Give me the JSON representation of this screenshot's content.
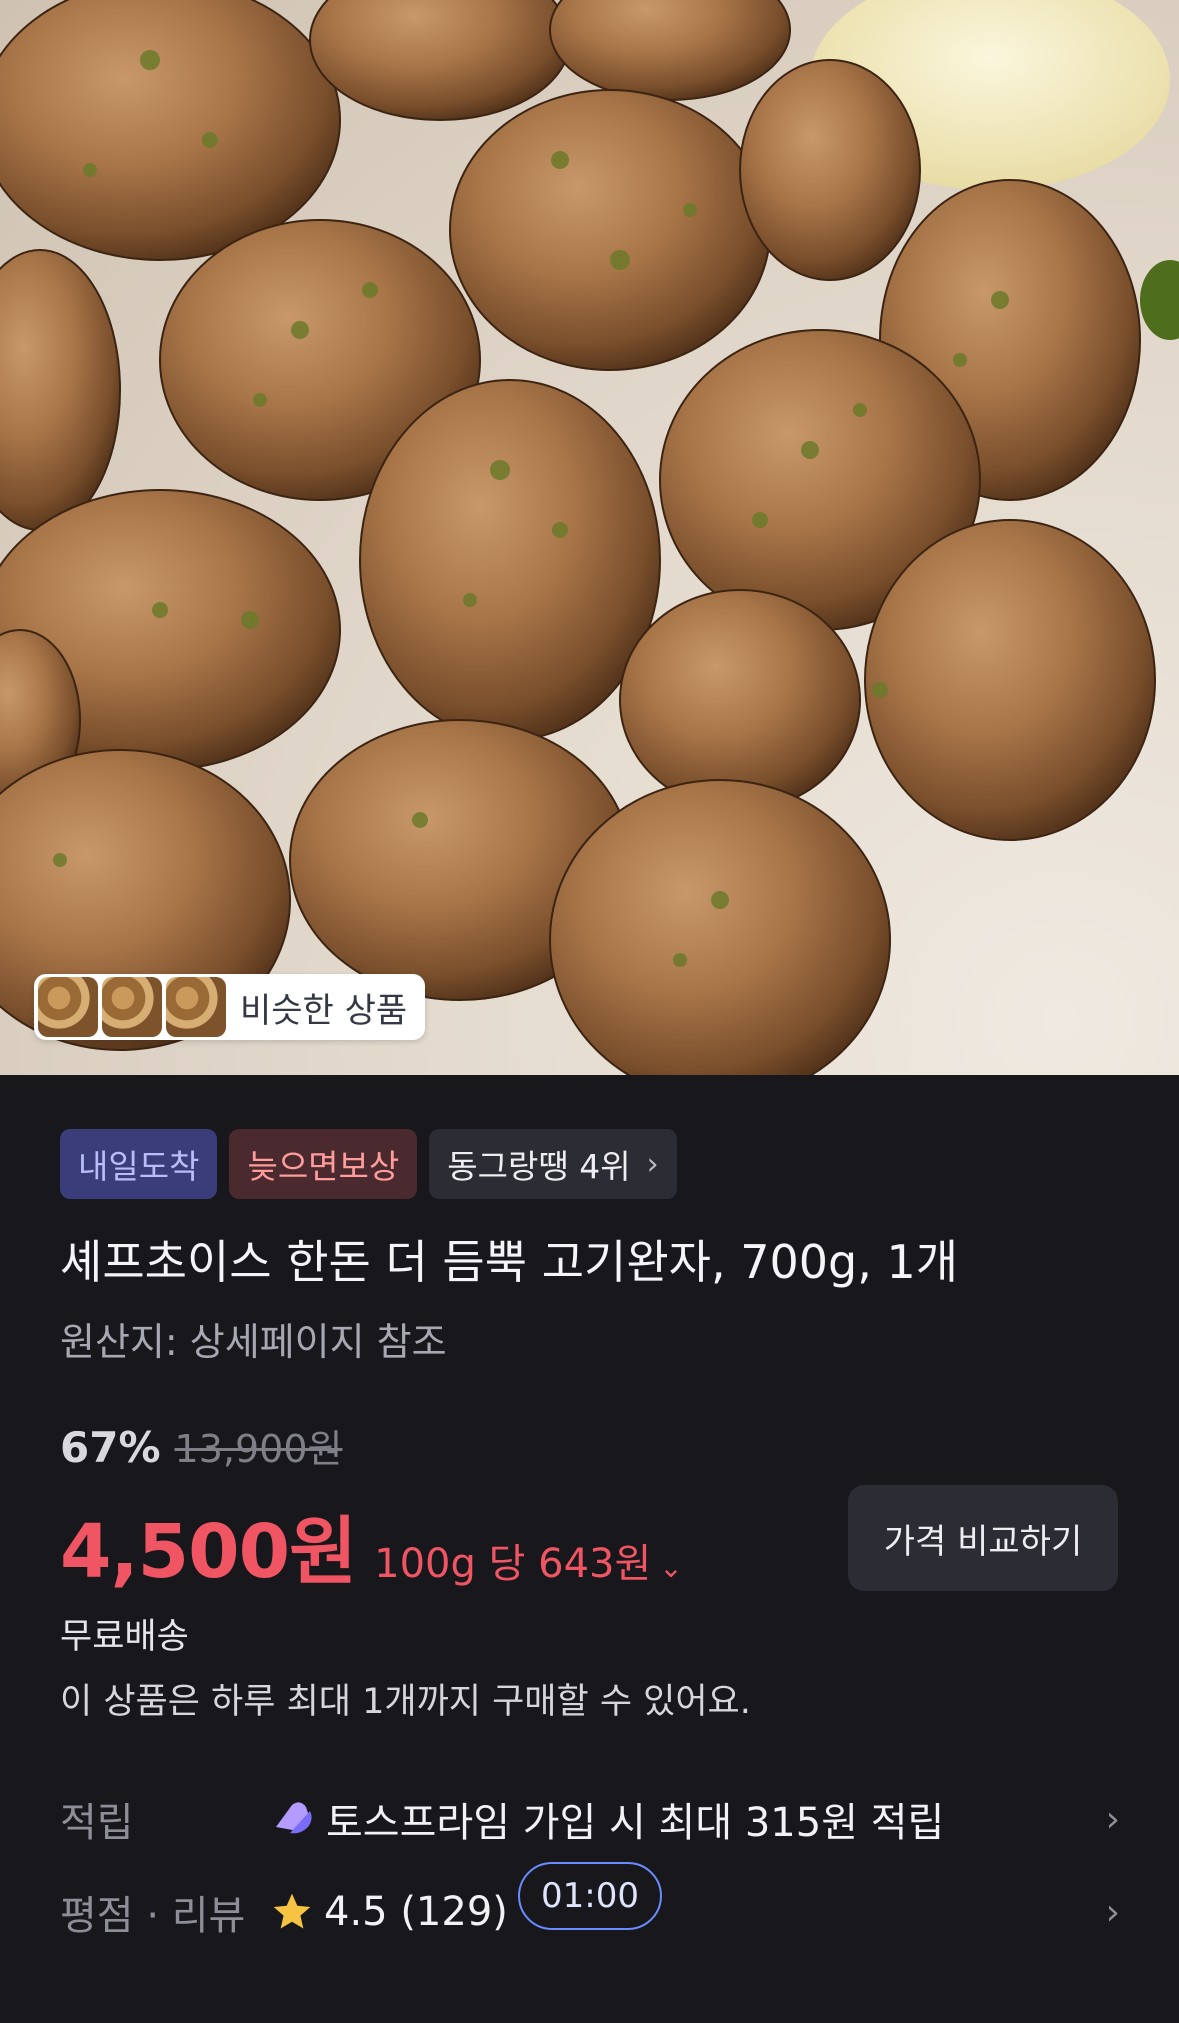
{
  "hero": {
    "image": "meatballs-product-photo",
    "similar_label": "비슷한 상품"
  },
  "tags": [
    {
      "label": "내일도착"
    },
    {
      "label": "늦으면보상"
    },
    {
      "label": "동그랑땡 4위"
    }
  ],
  "product": {
    "title": "셰프초이스 한돈 더 듬뿍 고기완자, 700g, 1개",
    "origin": "원산지: 상세페이지 참조",
    "discount": "67%",
    "original_price": "13,900원",
    "price": "4,500원",
    "unit_price": "100g 당 643원",
    "compare_button": "가격 비교하기",
    "shipping": "무료배송",
    "purchase_limit": "이 상품은 하루 최대 1개까지 구매할 수 있어요."
  },
  "info": {
    "points_key": "적립",
    "points_value": "토스프라임 가입 시 최대 315원 적립",
    "review_key": "평점 · 리뷰",
    "review_value": "4.5 (129)"
  },
  "timer": "01:00",
  "colors": {
    "background": "#17171c",
    "price_red": "#f05563",
    "tag_blue_bg": "#3a3d7a",
    "tag_red_bg": "#4a2a2e"
  }
}
